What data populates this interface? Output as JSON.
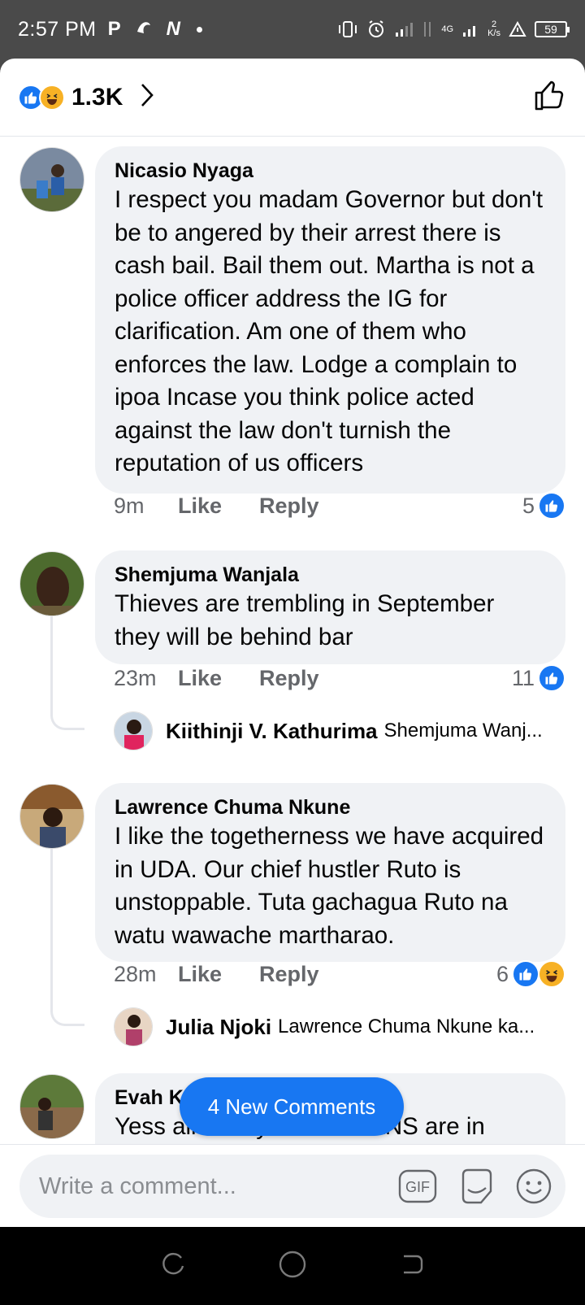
{
  "status_bar": {
    "time": "2:57 PM",
    "net_speed_value": "2",
    "net_speed_unit": "K/s",
    "signal_label": "4G",
    "battery": "59"
  },
  "header": {
    "reaction_count": "1.3K"
  },
  "comments": [
    {
      "author": "Nicasio Nyaga",
      "text": "I respect you madam Governor but don't be to angered by their arrest there is cash bail. Bail them out. Martha is not a police officer address the IG for clarification. Am one of them who enforces the law. Lodge a complain to ipoa Incase you think police acted against the law don't turnish the reputation of us officers",
      "time": "9m",
      "like_label": "Like",
      "reply_label": "Reply",
      "reactions": "5"
    },
    {
      "author": "Shemjuma Wanjala",
      "text": "Thieves are trembling in September they will be behind bar",
      "time": "23m",
      "like_label": "Like",
      "reply_label": "Reply",
      "reactions": "11",
      "reply": {
        "author": "Kiithinji V. Kathurima",
        "snippet": "Shemjuma Wanj..."
      }
    },
    {
      "author": "Lawrence Chuma Nkune",
      "text": "I like the togetherness we have acquired in UDA. Our chief hustler Ruto is unstoppable. Tuta gachagua Ruto na watu wawache martharao.",
      "time": "28m",
      "like_label": "Like",
      "reply_label": "Reply",
      "reactions": "6",
      "reply": {
        "author": "Julia Njoki",
        "snippet": "Lawrence Chuma Nkune ka..."
      }
    },
    {
      "author": "Evah K",
      "text": "Yess all nearly all KENYANS are in"
    }
  ],
  "new_comments_pill": "4 New Comments",
  "composer": {
    "placeholder": "Write a comment...",
    "gif_label": "GIF"
  },
  "colors": {
    "accent": "#1877f2",
    "bubble": "#f0f2f5",
    "secondary_text": "#65676b"
  }
}
